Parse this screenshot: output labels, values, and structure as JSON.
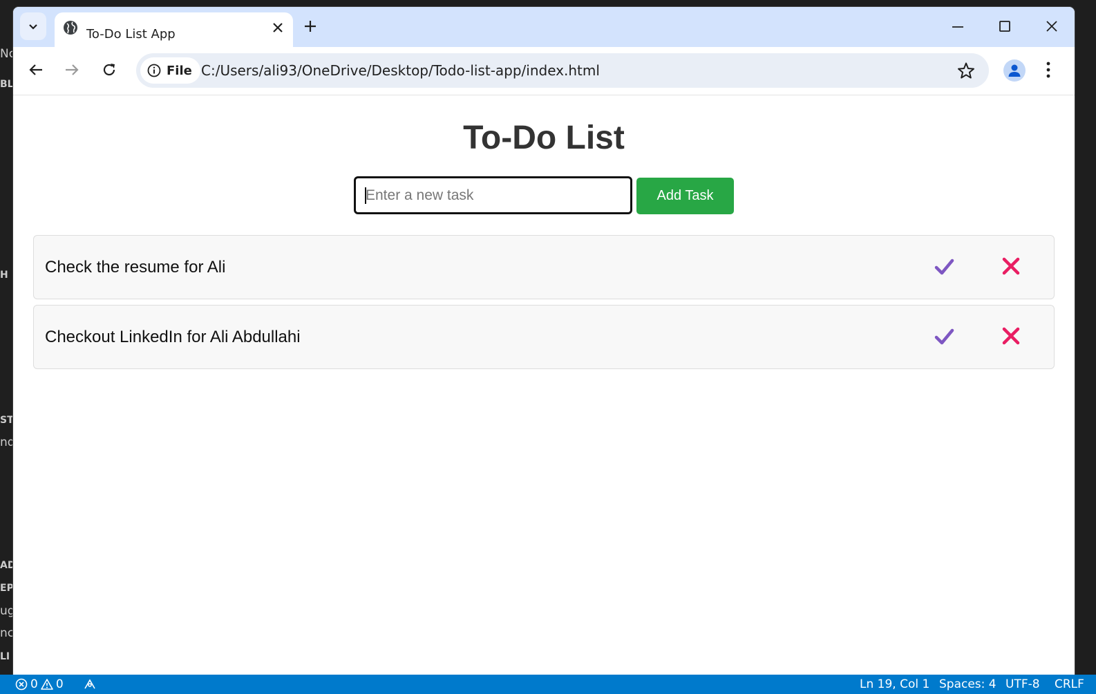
{
  "background_editor": {
    "fragments": [
      "No",
      "BL",
      "H",
      "STA",
      "nd",
      "AD S",
      "EPO",
      "ug",
      "nca",
      "LI"
    ]
  },
  "browser": {
    "tab": {
      "title": "To-Do List App"
    },
    "address": {
      "chip_label": "File",
      "url": "C:/Users/ali93/OneDrive/Desktop/Todo-list-app/index.html"
    }
  },
  "app": {
    "title": "To-Do List",
    "input": {
      "placeholder": "Enter a new task",
      "value": ""
    },
    "add_button_label": "Add Task",
    "tasks": [
      {
        "text": "Check the resume for Ali"
      },
      {
        "text": "Checkout LinkedIn for Ali Abdullahi"
      }
    ],
    "colors": {
      "add_button": "#28a745",
      "check_icon": "#7e57c2",
      "delete_icon": "#e91e63"
    }
  },
  "statusbar": {
    "errors": "0",
    "warnings": "0",
    "position": "Ln 19, Col 1",
    "spaces": "Spaces: 4",
    "encoding": "UTF-8",
    "eol": "CRLF"
  }
}
